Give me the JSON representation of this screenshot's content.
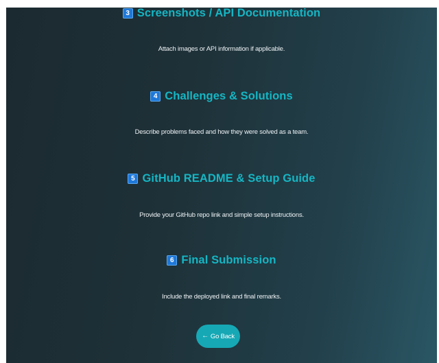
{
  "sections": [
    {
      "number": "3",
      "title": "Screenshots / API Documentation",
      "description": "Attach images or API information if applicable."
    },
    {
      "number": "4",
      "title": "Challenges & Solutions",
      "description": "Describe problems faced and how they were solved as a team."
    },
    {
      "number": "5",
      "title": "GitHub README & Setup Guide",
      "description": "Provide your GitHub repo link and simple setup instructions."
    },
    {
      "number": "6",
      "title": "Final Submission",
      "description": "Include the deployed link and final remarks."
    }
  ],
  "back_button": {
    "icon": "←",
    "label": "Go Back"
  },
  "colors": {
    "heading": "#15b6c4",
    "number_badge": "#1f78d8",
    "button": "#16a8b5"
  }
}
